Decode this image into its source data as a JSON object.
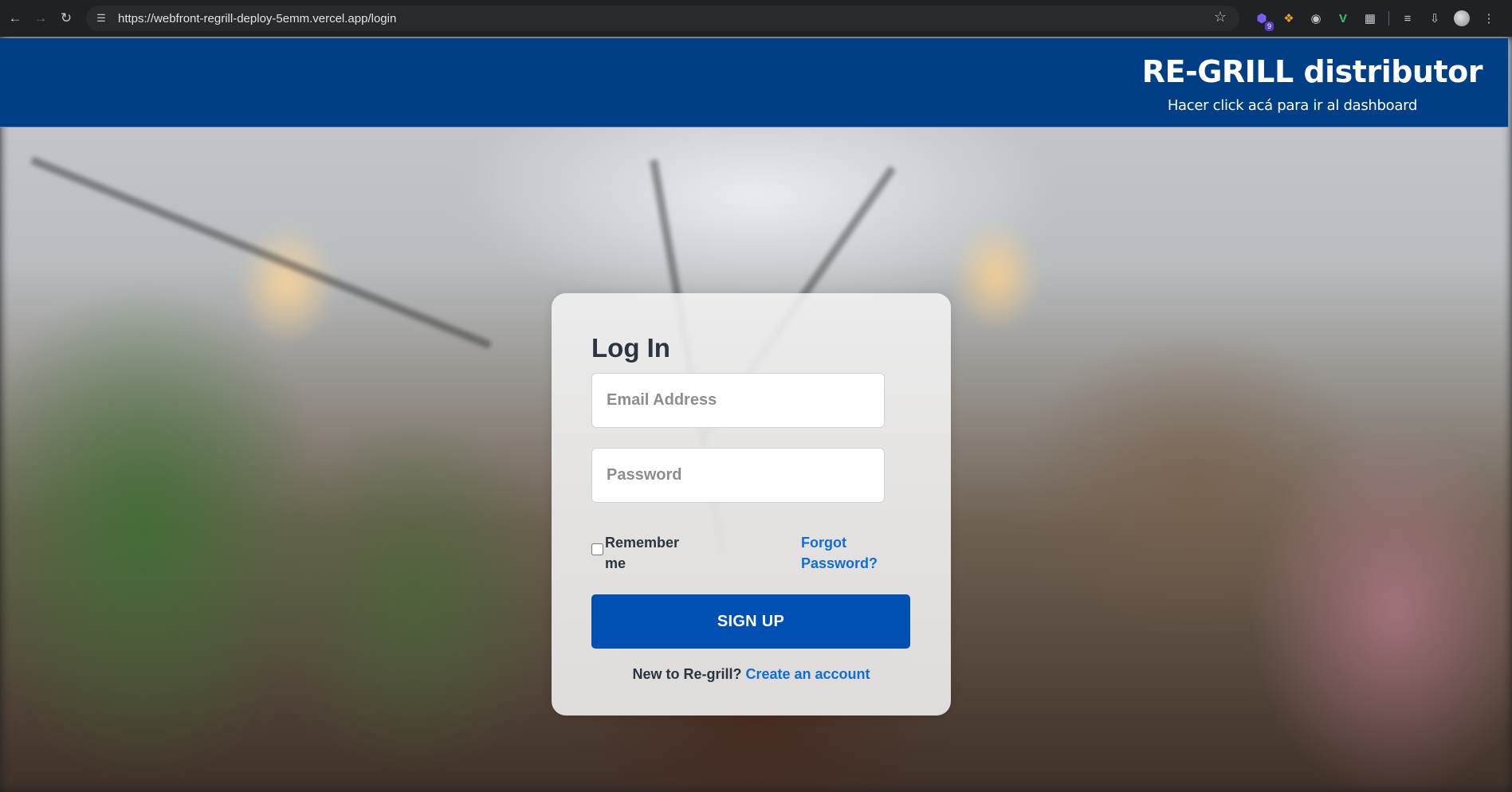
{
  "browser": {
    "url": "https://webfront-regrill-deploy-5emm.vercel.app/login",
    "extension_badge": "9"
  },
  "header": {
    "title": "RE-GRILL distributor",
    "dashboard_link": "Hacer click acá para ir al dashboard",
    "color": "#003e85"
  },
  "login": {
    "title": "Log In",
    "email_placeholder": "Email Address",
    "password_placeholder": "Password",
    "remember_label": "Remember me",
    "forgot_label": "Forgot Password?",
    "signup_button": "SIGN UP",
    "new_prompt": "New to Re-grill?",
    "create_link": "Create an account",
    "button_color": "#0050b3",
    "link_color": "#0d6fd6"
  },
  "icons": {
    "back": "arrow-left",
    "forward": "arrow-right",
    "reload": "reload",
    "site_info": "tune",
    "bookmark": "star",
    "menu": "kebab"
  }
}
